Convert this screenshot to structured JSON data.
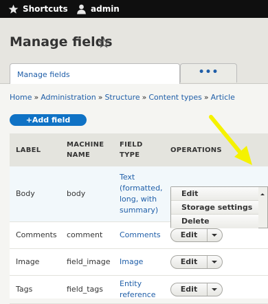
{
  "toolbar": {
    "shortcuts_label": "Shortcuts",
    "user_label": "admin"
  },
  "header": {
    "title": "Manage fields",
    "tabs": [
      {
        "label": "Manage fields"
      },
      {
        "label": "•••"
      }
    ]
  },
  "breadcrumb": [
    {
      "label": "Home"
    },
    {
      "label": "Administration"
    },
    {
      "label": "Structure"
    },
    {
      "label": "Content types"
    },
    {
      "label": "Article"
    }
  ],
  "breadcrumb_separator": "»",
  "add_field": {
    "label": "+Add field"
  },
  "table": {
    "headers": {
      "label": "LABEL",
      "machine_name_1": "MACHINE",
      "machine_name_2": "NAME",
      "field_type_1": "FIELD",
      "field_type_2": "TYPE",
      "operations": "OPERATIONS"
    },
    "rows": [
      {
        "label": "Body",
        "machine_name": "body",
        "field_type_lines": [
          "Text",
          "(formatted,",
          "long, with",
          "summary)"
        ]
      },
      {
        "label": "Comments",
        "machine_name": "comment",
        "field_type_lines": [
          "Comments"
        ],
        "edit_label": "Edit"
      },
      {
        "label": "Image",
        "machine_name": "field_image",
        "field_type_lines": [
          "Image"
        ],
        "edit_label": "Edit"
      },
      {
        "label": "Tags",
        "machine_name": "field_tags",
        "field_type_lines": [
          "Entity",
          "reference"
        ],
        "edit_label": "Edit"
      }
    ]
  },
  "dropdown": {
    "items": [
      {
        "label": "Edit"
      },
      {
        "label": "Storage settings"
      },
      {
        "label": "Delete"
      }
    ]
  },
  "colors": {
    "link": "#1f5ea8",
    "primary_button": "#0f72c5",
    "toolbar": "#0f0f0f",
    "annotation_arrow": "#f5f200"
  }
}
